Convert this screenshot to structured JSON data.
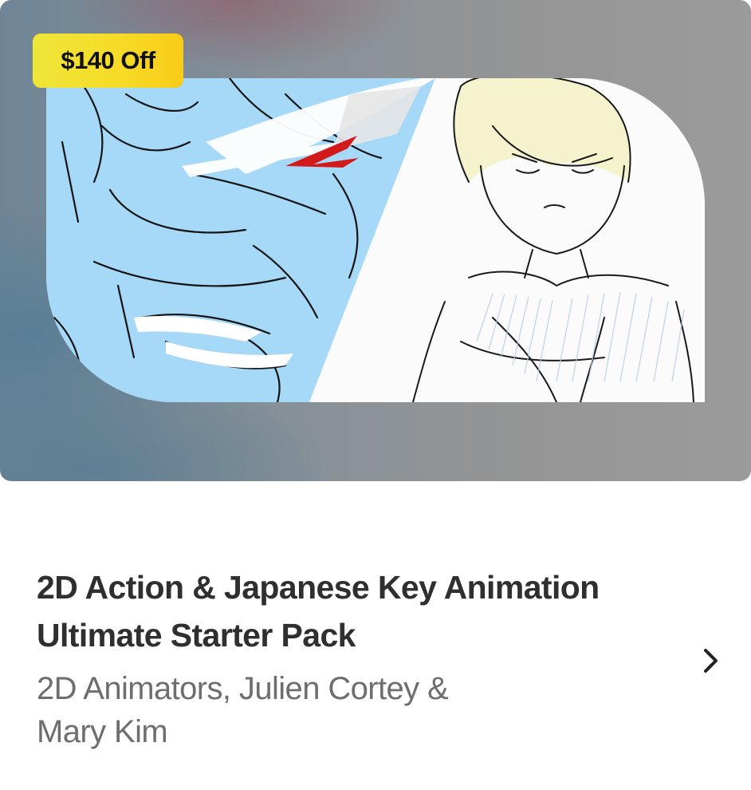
{
  "course": {
    "badge": "$140 Off",
    "title_line1": "2D Action & Japanese Key Animation",
    "title_line2": "Ultimate Starter Pack",
    "authors_line1": "2D Animators, Julien Cortey &",
    "authors_line2": "Mary Kim"
  },
  "icons": {
    "open": "chevron-right-icon"
  },
  "colors": {
    "badge_yellow": "#f5dc28",
    "title": "#2f2f2f",
    "subtitle": "#6e6e6e",
    "sketch_blue": "#9fd4f5"
  }
}
